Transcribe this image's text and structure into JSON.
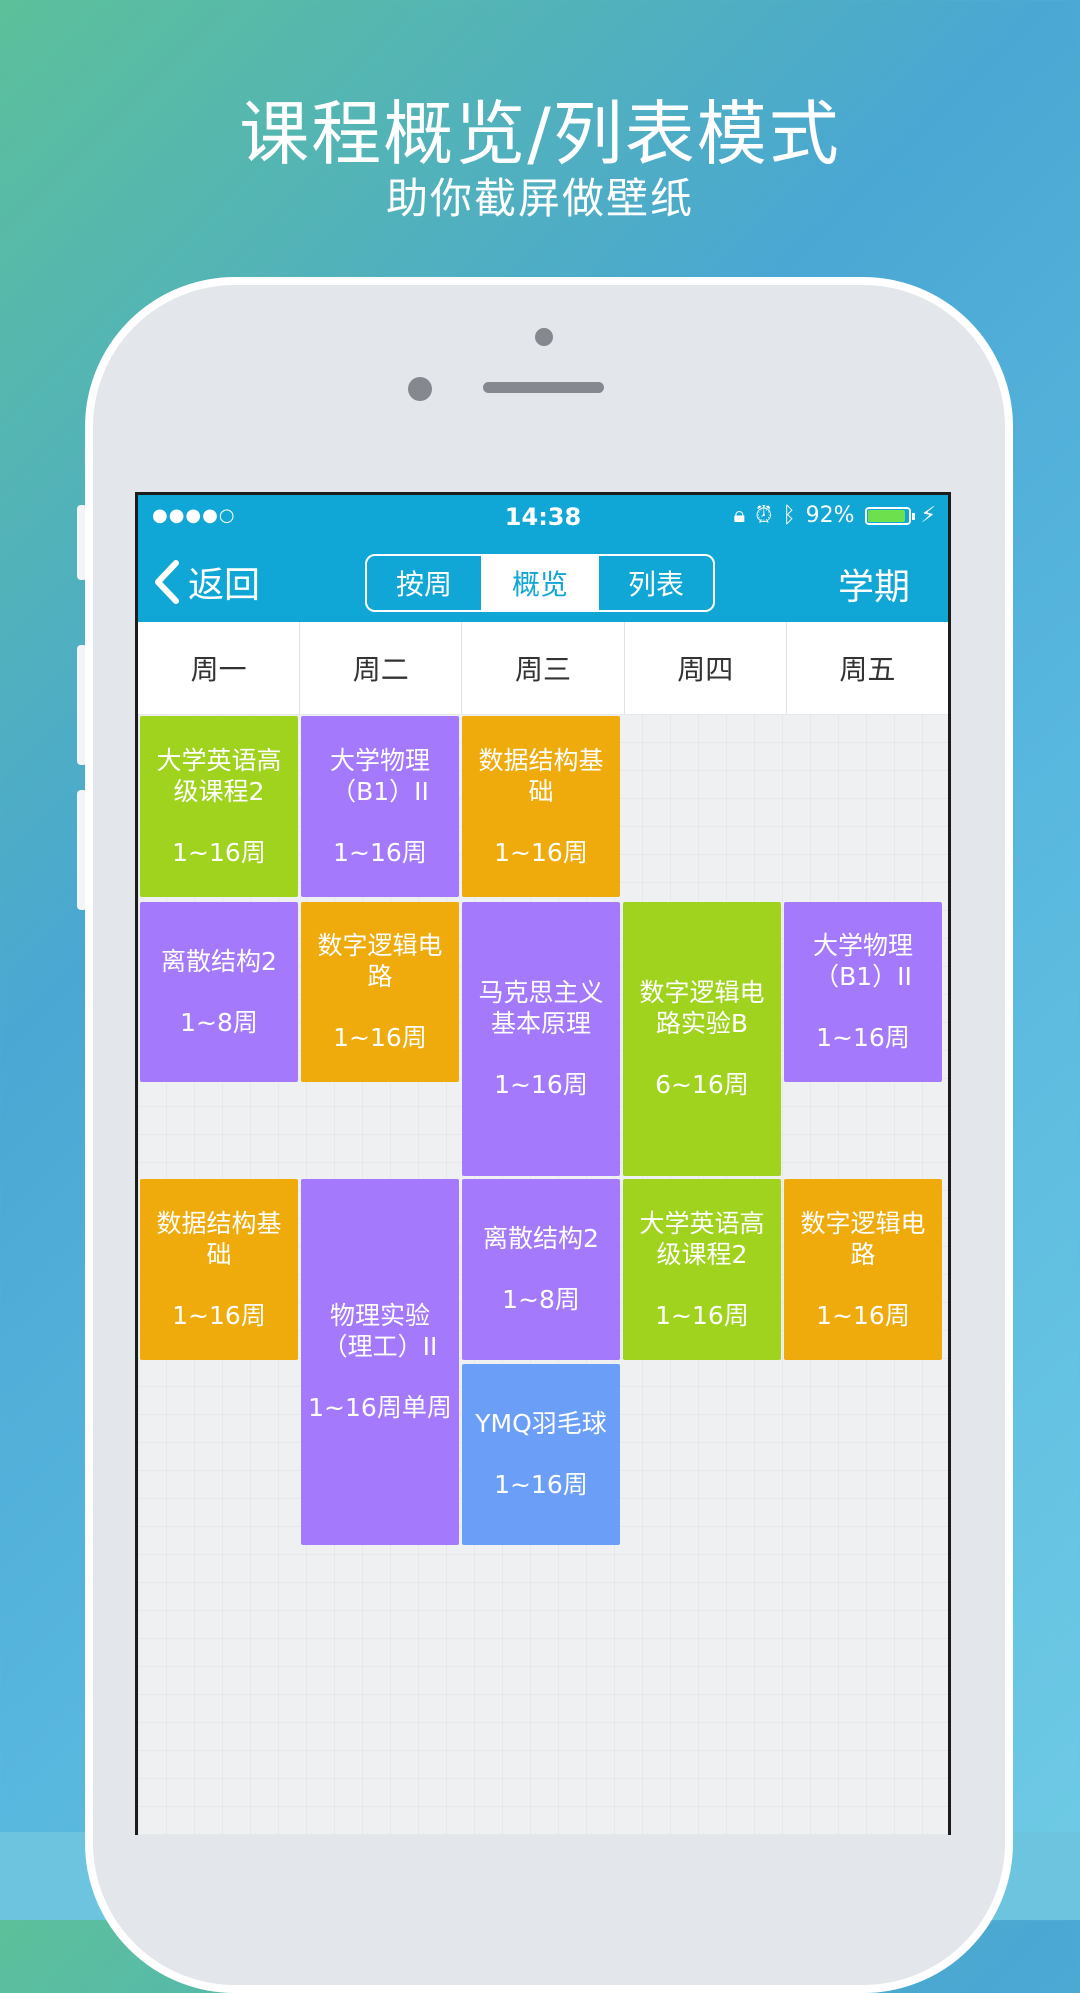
{
  "hero": {
    "title": "课程概览/列表模式",
    "subtitle": "助你截屏做壁纸"
  },
  "status": {
    "signal": "●●●●○",
    "time": "14:38",
    "battery": "92%",
    "battery_level": 0.92,
    "icons": [
      "rotation-lock-icon",
      "alarm-icon",
      "bluetooth-icon",
      "charging-icon"
    ]
  },
  "nav": {
    "back_label": "返回",
    "tabs": [
      {
        "label": "按周"
      },
      {
        "label": "概览",
        "active": true
      },
      {
        "label": "列表"
      }
    ],
    "term_label": "学期"
  },
  "days": [
    "周一",
    "周二",
    "周三",
    "周四",
    "周五"
  ],
  "colors": {
    "bar": "#10a6d6",
    "green": "#9fd31d",
    "purple": "#a579fb",
    "orange": "#efaa0c",
    "blue": "#6b9ff7"
  },
  "courses": [
    {
      "name": "大学英语高级课程2",
      "weeks": "1~16周",
      "color": "green"
    },
    {
      "name": "大学物理（B1）II",
      "weeks": "1~16周",
      "color": "purple"
    },
    {
      "name": "数据结构基础",
      "weeks": "1~16周",
      "color": "orange"
    },
    {
      "name": "离散结构2",
      "weeks": "1~8周",
      "color": "purple"
    },
    {
      "name": "数字逻辑电路",
      "weeks": "1~16周",
      "color": "orange"
    },
    {
      "name": "马克思主义基本原理",
      "weeks": "1~16周",
      "color": "purple"
    },
    {
      "name": "数字逻辑电路实验B",
      "weeks": "6~16周",
      "color": "green"
    },
    {
      "name": "大学物理（B1）II",
      "weeks": "1~16周",
      "color": "purple"
    },
    {
      "name": "数据结构基础",
      "weeks": "1~16周",
      "color": "orange"
    },
    {
      "name": "物理实验（理工）II",
      "weeks": "1~16周单周",
      "color": "purple"
    },
    {
      "name": "离散结构2",
      "weeks": "1~8周",
      "color": "purple"
    },
    {
      "name": "大学英语高级课程2",
      "weeks": "1~16周",
      "color": "green"
    },
    {
      "name": "数字逻辑电路",
      "weeks": "1~16周",
      "color": "orange"
    },
    {
      "name": "YMQ羽毛球",
      "weeks": "1~16周",
      "color": "blue"
    }
  ]
}
